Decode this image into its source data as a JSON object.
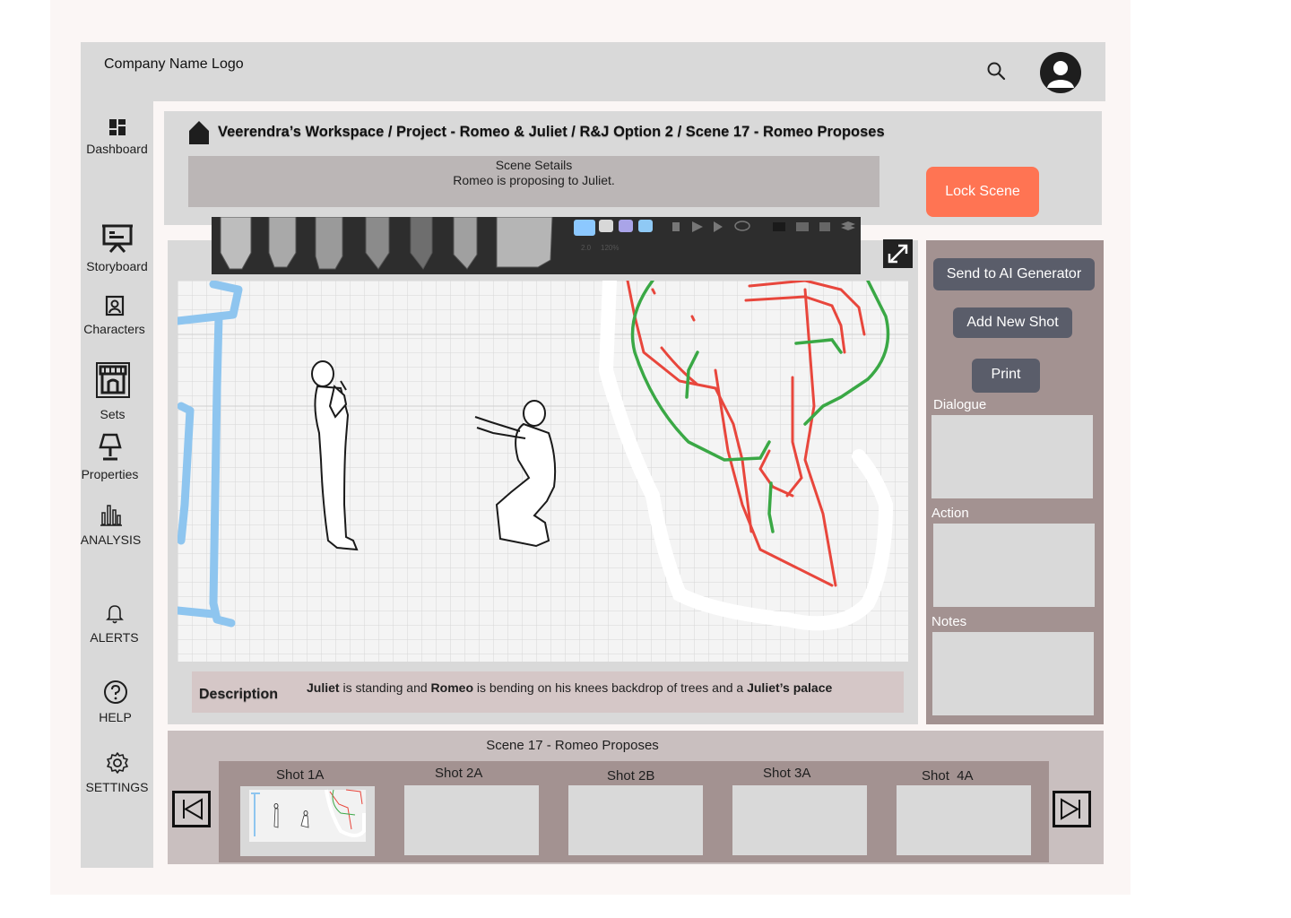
{
  "app": {
    "logo_text": "Company Name Logo"
  },
  "sidebar": {
    "items": [
      {
        "label": "Dashboard",
        "icon": "dashboard-icon"
      },
      {
        "label": "Storyboard",
        "icon": "presentation-board-icon"
      },
      {
        "label": "Characters",
        "icon": "portrait-icon"
      },
      {
        "label": "Sets",
        "icon": "storefront-icon"
      },
      {
        "label": "Properties",
        "icon": "lamp-icon"
      },
      {
        "label": "ANALYSIS",
        "icon": "bar-chart-icon"
      },
      {
        "label": "ALERTS",
        "icon": "bell-icon"
      },
      {
        "label": "HELP",
        "icon": "help-circle-icon"
      },
      {
        "label": "SETTINGS",
        "icon": "gear-icon"
      }
    ]
  },
  "header": {
    "breadcrumb": "Veerendra’s Workspace / Project - Romeo & Juliet / R&J Option 2 / Scene 17 - Romeo Proposes",
    "scene_details_title": "Scene Setails",
    "scene_details_text": "Romeo is proposing to Juliet.",
    "lock_button": "Lock Scene"
  },
  "canvas": {
    "description_label": "Description",
    "description": [
      {
        "text": "Juliet",
        "bold": true
      },
      {
        "text": " is standing and ",
        "bold": false
      },
      {
        "text": "Romeo",
        "bold": true
      },
      {
        "text": " is bending on his knees backdrop of trees and a ",
        "bold": false
      },
      {
        "text": "Juliet’s palace",
        "bold": true
      }
    ],
    "toolbar": {
      "swatch_colors": [
        "#8cc8ff",
        "#d8d8d8",
        "#a9a4e8",
        "#8fc9f5"
      ],
      "small_labels": [
        "2.0",
        "120%"
      ]
    },
    "stroke_colors": {
      "blue": "#8ec5ef",
      "red": "#e8463c",
      "green": "#3aa845",
      "white": "#ffffff"
    }
  },
  "right_panel": {
    "send_ai": "Send to AI  Generator",
    "add_shot": "Add New Shot",
    "print": "Print",
    "dialogue_label": "Dialogue",
    "action_label": "Action",
    "notes_label": "Notes"
  },
  "shots": {
    "title": "Scene 17 - Romeo Proposes",
    "items": [
      "Shot 1A",
      "Shot 2A",
      "Shot 2B",
      "Shot 3A",
      "Shot  4A"
    ]
  },
  "colors": {
    "accent": "#ff7453",
    "button": "#5a5d6a",
    "panel": "#a39291"
  }
}
